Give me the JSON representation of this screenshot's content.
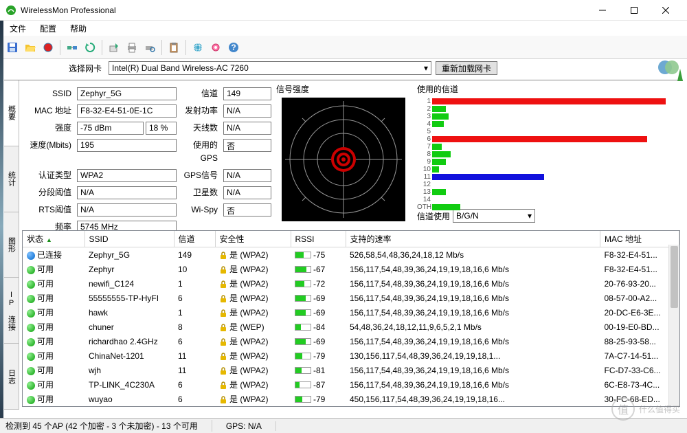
{
  "window": {
    "title": "WirelessMon Professional"
  },
  "menu": {
    "file": "文件",
    "config": "配置",
    "help": "帮助"
  },
  "adapter": {
    "label": "选择网卡",
    "value": "Intel(R) Dual Band Wireless-AC 7260",
    "reload": "重新加载网卡"
  },
  "side_tabs": [
    "概要",
    "统计",
    "图形",
    "IP 连接",
    "日志"
  ],
  "sections": {
    "signal": "信号强度",
    "channels": "使用的信道"
  },
  "channel_selector": {
    "label": "信道使用",
    "value": "B/G/N"
  },
  "fields": {
    "ssid_l": "SSID",
    "ssid": "Zephyr_5G",
    "chan_l": "信道",
    "chan": "149",
    "mac_l": "MAC 地址",
    "mac": "F8-32-E4-51-0E-1C",
    "txpower_l": "发射功率",
    "txpower": "N/A",
    "strength_l": "强度",
    "strength_dbm": "-75 dBm",
    "strength_pct": "18 %",
    "antenna_l": "天线数",
    "antenna": "N/A",
    "speed_l": "速度(Mbits)",
    "speed": "195",
    "gps_l": "使用的GPS",
    "gps": "否",
    "auth_l": "认证类型",
    "auth": "WPA2",
    "gpssig_l": "GPS信号",
    "gpssig": "N/A",
    "frag_l": "分段阈值",
    "frag": "N/A",
    "sat_l": "卫星数",
    "sat": "N/A",
    "rts_l": "RTS阈值",
    "rts": "N/A",
    "wispy_l": "Wi-Spy",
    "wispy": "否",
    "freq_l": "频率",
    "freq": "5745 MHz"
  },
  "chart_data": {
    "type": "bar",
    "title": "使用的信道",
    "xlabel": "",
    "ylabel": "",
    "categories": [
      "1",
      "2",
      "3",
      "4",
      "5",
      "6",
      "7",
      "8",
      "9",
      "10",
      "11",
      "12",
      "13",
      "14",
      "OTH"
    ],
    "values": [
      100,
      6,
      7,
      5,
      0,
      92,
      4,
      8,
      6,
      3,
      48,
      0,
      6,
      0,
      12
    ],
    "colors": [
      "#e11",
      "#1c1",
      "#1c1",
      "#1c1",
      "#1c1",
      "#e11",
      "#1c1",
      "#1c1",
      "#1c1",
      "#1c1",
      "#11d",
      "#1c1",
      "#1c1",
      "#1c1",
      "#1c1"
    ]
  },
  "table": {
    "headers": {
      "status": "状态",
      "ssid": "SSID",
      "channel": "信道",
      "security": "安全性",
      "rssi": "RSSI",
      "rates": "支持的速率",
      "mac": "MAC 地址"
    },
    "status_connected": "已连接",
    "status_available": "可用",
    "sec_yes": "是",
    "rows": [
      {
        "st": "connected",
        "ssid": "Zephyr_5G",
        "ch": "149",
        "sec": "WPA2",
        "rssi": -75,
        "rates": "526,58,54,48,36,24,18,12 Mb/s",
        "mac": "F8-32-E4-51..."
      },
      {
        "st": "avail",
        "ssid": "Zephyr",
        "ch": "10",
        "sec": "WPA2",
        "rssi": -67,
        "rates": "156,117,54,48,39,36,24,19,19,18,16,6 Mb/s",
        "mac": "F8-32-E4-51..."
      },
      {
        "st": "avail",
        "ssid": "newifi_C124",
        "ch": "1",
        "sec": "WPA2",
        "rssi": -72,
        "rates": "156,117,54,48,39,36,24,19,19,18,16,6 Mb/s",
        "mac": "20-76-93-20..."
      },
      {
        "st": "avail",
        "ssid": "55555555-TP-HyFI",
        "ch": "6",
        "sec": "WPA2",
        "rssi": -69,
        "rates": "156,117,54,48,39,36,24,19,19,18,16,6 Mb/s",
        "mac": "08-57-00-A2..."
      },
      {
        "st": "avail",
        "ssid": "hawk",
        "ch": "1",
        "sec": "WPA2",
        "rssi": -69,
        "rates": "156,117,54,48,39,36,24,19,19,18,16,6 Mb/s",
        "mac": "20-DC-E6-3E..."
      },
      {
        "st": "avail",
        "ssid": "chuner",
        "ch": "8",
        "sec": "WEP",
        "rssi": -84,
        "rates": "54,48,36,24,18,12,11,9,6,5,2,1 Mb/s",
        "mac": "00-19-E0-BD..."
      },
      {
        "st": "avail",
        "ssid": "richardhao 2.4GHz",
        "ch": "6",
        "sec": "WPA2",
        "rssi": -69,
        "rates": "156,117,54,48,39,36,24,19,19,18,16,6 Mb/s",
        "mac": "88-25-93-58..."
      },
      {
        "st": "avail",
        "ssid": "ChinaNet-1201",
        "ch": "11",
        "sec": "WPA2",
        "rssi": -79,
        "rates": "130,156,117,54,48,39,36,24,19,19,18,1...",
        "mac": "7A-C7-14-51..."
      },
      {
        "st": "avail",
        "ssid": "wjh",
        "ch": "11",
        "sec": "WPA2",
        "rssi": -81,
        "rates": "156,117,54,48,39,36,24,19,19,18,16,6 Mb/s",
        "mac": "FC-D7-33-C6..."
      },
      {
        "st": "avail",
        "ssid": "TP-LINK_4C230A",
        "ch": "6",
        "sec": "WPA2",
        "rssi": -87,
        "rates": "156,117,54,48,39,36,24,19,19,18,16,6 Mb/s",
        "mac": "6C-E8-73-4C..."
      },
      {
        "st": "avail",
        "ssid": "wuyao",
        "ch": "6",
        "sec": "WPA2",
        "rssi": -79,
        "rates": "450,156,117,54,48,39,36,24,19,19,18,16...",
        "mac": "30-FC-68-ED..."
      }
    ]
  },
  "statusbar": {
    "aps": "检测到 45 个AP (42 个加密 - 3 个未加密) - 13 个可用",
    "gps": "GPS: N/A"
  },
  "watermark": "什么值得买"
}
